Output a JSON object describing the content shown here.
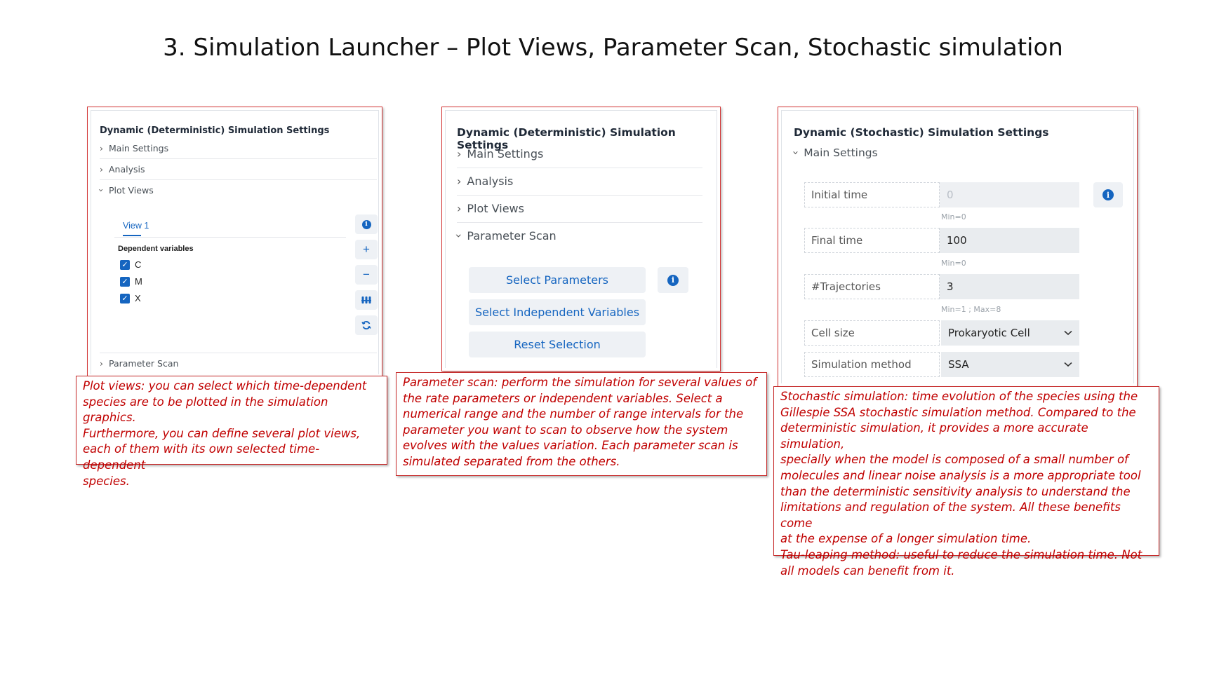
{
  "slide_title": "3. Simulation Launcher – Plot Views, Parameter Scan, Stochastic simulation",
  "panel1": {
    "title": "Dynamic (Deterministic) Simulation Settings",
    "sections": [
      "Main Settings",
      "Analysis",
      "Plot Views",
      "Parameter Scan"
    ],
    "tab_label": "View 1",
    "dependent_label": "Dependent variables",
    "variables": [
      "C",
      "M",
      "X"
    ],
    "icons": [
      "info-icon",
      "plus-icon",
      "minus-icon",
      "columns-icon",
      "refresh-icon"
    ]
  },
  "panel2": {
    "title": "Dynamic (Deterministic) Simulation Settings",
    "sections": [
      "Main Settings",
      "Analysis",
      "Plot Views",
      "Parameter Scan"
    ],
    "buttons": [
      "Select Parameters",
      "Select Independent Variables",
      "Reset Selection"
    ]
  },
  "panel3": {
    "title": "Dynamic (Stochastic) Simulation Settings",
    "section": "Main Settings",
    "fields": [
      {
        "label": "Initial time",
        "value": "0",
        "hint": "Min=0"
      },
      {
        "label": "Final time",
        "value": "100",
        "hint": "Min=0"
      },
      {
        "label": "#Trajectories",
        "value": "3",
        "hint": "Min=1 ; Max=8"
      },
      {
        "label": "Cell size",
        "value": "Prokaryotic Cell",
        "hint": ""
      },
      {
        "label": "Simulation method",
        "value": "SSA",
        "hint": ""
      }
    ]
  },
  "notes": {
    "plot_views": "Plot views: you can select which time-dependent\nspecies are to be plotted in the simulation graphics.\nFurthermore, you can define several plot views,\neach of them with its own selected time-dependent\nspecies.",
    "parameter_scan": "Parameter scan: perform the simulation for several values of\nthe rate parameters or independent variables. Select a\nnumerical range and the number of range intervals for the\nparameter you want to scan to observe how the system\nevolves with the values variation. Each parameter scan is\nsimulated separated from the others.",
    "stochastic": "Stochastic simulation: time evolution of the species using the\nGillespie SSA stochastic simulation method. Compared to the\ndeterministic simulation, it provides a more accurate simulation,\nspecially when the model is composed of a small number of\nmolecules and linear noise analysis is a more appropriate tool\nthan the deterministic sensitivity analysis to understand the\nlimitations and regulation of the system. All these benefits come\nat the expense of a longer simulation time.\nTau-leaping method: useful to reduce the simulation time. Not\nall models can benefit from it."
  },
  "colors": {
    "accent": "#1565c0",
    "note_text": "#c00000",
    "frame": "#d33333"
  }
}
